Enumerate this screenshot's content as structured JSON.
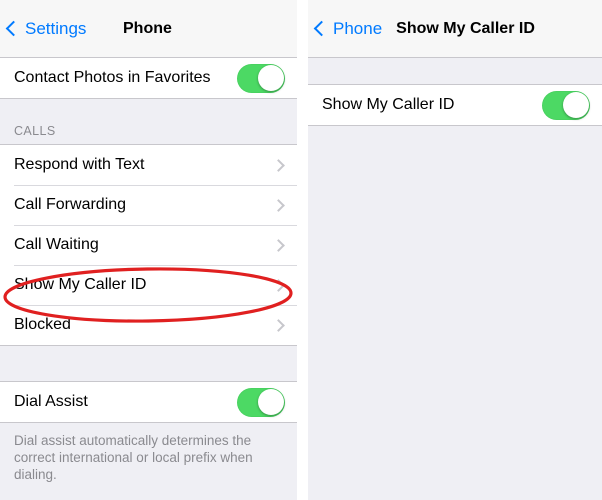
{
  "left_panel": {
    "navbar": {
      "back_label": "Settings",
      "back_icon": "chevron-left-icon",
      "title": "Phone"
    },
    "group_top": {
      "rows": [
        {
          "label": "Contact Photos in Favorites",
          "accessory": "toggle",
          "toggle_on": true
        }
      ]
    },
    "section_calls": {
      "header": "CALLS",
      "rows": [
        {
          "label": "Respond with Text",
          "accessory": "disclosure"
        },
        {
          "label": "Call Forwarding",
          "accessory": "disclosure"
        },
        {
          "label": "Call Waiting",
          "accessory": "disclosure"
        },
        {
          "label": "Show My Caller ID",
          "accessory": "disclosure"
        },
        {
          "label": "Blocked",
          "accessory": "disclosure"
        }
      ]
    },
    "group_dial": {
      "rows": [
        {
          "label": "Dial Assist",
          "accessory": "toggle",
          "toggle_on": true
        }
      ],
      "footer_note": "Dial assist automatically determines the correct international or local prefix when dialing."
    }
  },
  "right_panel": {
    "navbar": {
      "back_label": "Phone",
      "back_icon": "chevron-left-icon",
      "title": "Show My Caller ID"
    },
    "group": {
      "rows": [
        {
          "label": "Show My Caller ID",
          "accessory": "toggle",
          "toggle_on": true
        }
      ]
    }
  },
  "annotations": {
    "color": "#e02020",
    "left_highlight_target": "Show My Caller ID",
    "right_highlight_target": "Show My Caller ID"
  },
  "colors": {
    "accent_blue": "#007aff",
    "toggle_green": "#4cd964",
    "background_gray": "#efeff4",
    "navbar_gray": "#f7f7f7",
    "separator": "#c8c7cc",
    "secondary_text": "#8a8a8f",
    "annotation_red": "#e02020"
  }
}
